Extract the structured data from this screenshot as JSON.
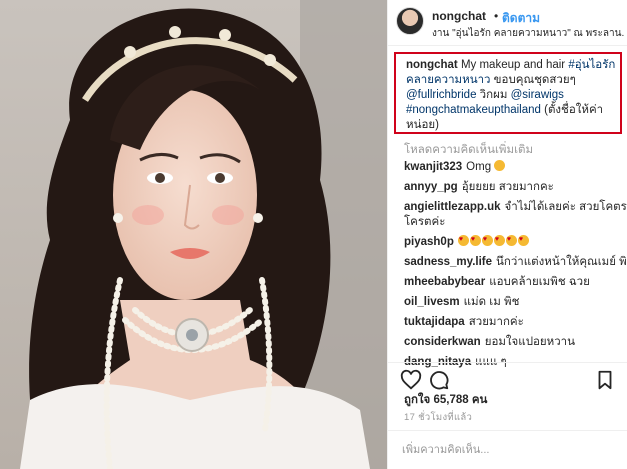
{
  "header": {
    "username": "nongchat",
    "separator": "•",
    "follow_label": "ติดตาม",
    "location": "งาน \"อุ่นไอรัก คลายความหนาว\" ณ พระลาน..."
  },
  "caption": {
    "username": "nongchat",
    "text1": " My makeup and hair ",
    "tag1": "#อุ่นไอรัก",
    "tag1b": "คลายความหนาว",
    "text2": " ขอบคุณชุดสวยๆ",
    "mention1": "@fullrichbride",
    "text3": " วิกผม ",
    "mention2": "@sirawigs",
    "tag2": "#nongchatmakeupthailand",
    "text4": " (ตั้งชื่อให้ค่า",
    "text5": "หน่อย)"
  },
  "load_more": "โหลดความคิดเห็นเพิ่มเติม",
  "comments": [
    {
      "user": "kwanjit323",
      "text": "Omg",
      "emoji": "face"
    },
    {
      "user": "annyy_pg",
      "text": "อุ้ยยยย สวยมากคะ",
      "emoji": ""
    },
    {
      "user": "angielittlezapp.uk",
      "text": "จำไม่ได้เลยค่ะ สวยโคตร",
      "text2": "โครตค่ะ",
      "emoji": ""
    },
    {
      "user": "piyash0p",
      "text": "",
      "emoji": "hearts"
    },
    {
      "user": "sadness_my.life",
      "text": "นึกว่าแต่งหน้าให้คุณเมย์ พิช",
      "emoji": ""
    },
    {
      "user": "mheebabybear",
      "text": "แอบคล้ายเมพิช ฉวย",
      "emoji": ""
    },
    {
      "user": "oil_livesm",
      "text": "แม่ด เม พิช",
      "emoji": ""
    },
    {
      "user": "tuktajidapa",
      "text": "สวยมากค่ะ",
      "emoji": ""
    },
    {
      "user": "considerkwan",
      "text": "ยอมใจแปอยหวาน",
      "emoji": ""
    },
    {
      "user": "dang_nitaya",
      "text": "แแแ ๆ",
      "emoji": ""
    }
  ],
  "likes": "ถูกใจ 65,788 คน",
  "time_ago": "17 ชั่วโมงที่แล้ว",
  "add_comment_placeholder": "เพิ่มความคิดเห็น...",
  "icons": {
    "like": "heart-icon",
    "comment": "comment-icon",
    "save": "bookmark-icon"
  },
  "colors": {
    "accent": "#3897f0",
    "highlight_border": "#d0021b",
    "muted": "#999999"
  }
}
